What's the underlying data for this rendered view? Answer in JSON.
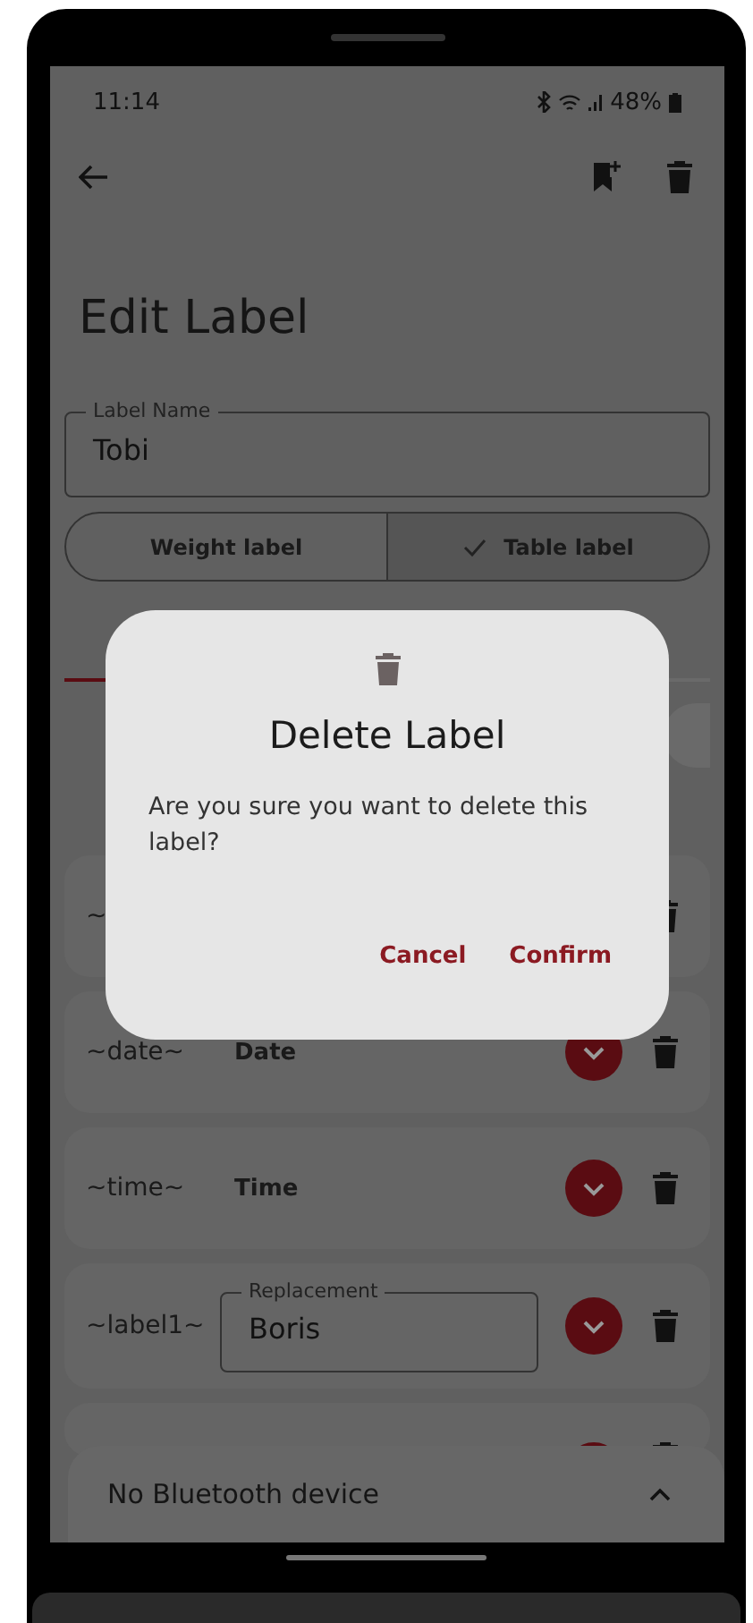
{
  "status_bar": {
    "time": "11:14",
    "battery": "48%"
  },
  "title": "Edit Label",
  "label_name": {
    "label": "Label Name",
    "value": "Tobi"
  },
  "segments": [
    {
      "label": "Weight label",
      "selected": false
    },
    {
      "label": "Table label",
      "selected": true
    }
  ],
  "rows": [
    {
      "kind": "text",
      "key": "~"
    },
    {
      "kind": "text",
      "key": "~date~",
      "value": "Date"
    },
    {
      "kind": "text",
      "key": "~time~",
      "value": "Time"
    },
    {
      "kind": "field",
      "key": "~label1~",
      "field_label": "Replacement",
      "value": "Boris"
    },
    {
      "kind": "cut"
    }
  ],
  "dialog": {
    "title": "Delete Label",
    "message": "Are you sure you want to delete this label?",
    "buttons": [
      "Cancel",
      "Confirm"
    ]
  },
  "bottom_sheet": {
    "text": "No Bluetooth device"
  }
}
